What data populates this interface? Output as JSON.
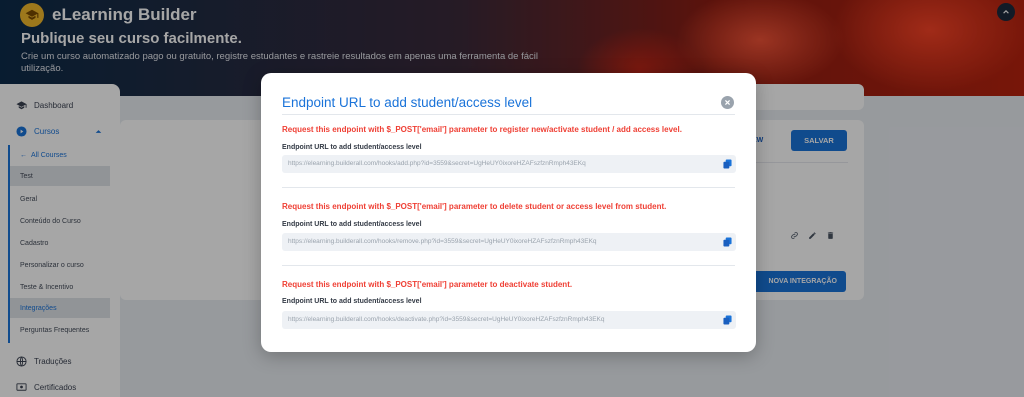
{
  "app": {
    "name": "eLearning Builder",
    "headline": "Publique seu curso facilmente.",
    "subline": "Crie um curso automatizado pago ou gratuito, registre estudantes e rastreie resultados em apenas uma ferramenta de fácil utilização."
  },
  "sidebar": {
    "dashboard": "Dashboard",
    "courses": "Cursos",
    "back": "All Courses",
    "sub_items": [
      "Test",
      "Geral",
      "Conteúdo do Curso",
      "Cadastro",
      "Personalizar o curso",
      "Teste & Incentivo",
      "Integrações",
      "Perguntas Frequentes"
    ],
    "translations": "Traduções",
    "certificates": "Certificados"
  },
  "background": {
    "view_button": "EW",
    "save_button": "SALVAR",
    "new_integration_button": "NOVA INTEGRAÇÃO"
  },
  "modal": {
    "title": "Endpoint URL to add student/access level",
    "sections": [
      {
        "warning": "Request this endpoint with $_POST['email'] parameter to register new/activate student / add access level.",
        "label": "Endpoint URL to add student/access level",
        "url": "https://elearning.builderall.com/hooks/add.php?id=3559&secret=UgHeUY0ixoreHZAFszfznRmph43EKq"
      },
      {
        "warning": "Request this endpoint with $_POST['email'] parameter to delete student or access level from student.",
        "label": "Endpoint URL to add student/access level",
        "url": "https://elearning.builderall.com/hooks/remove.php?id=3559&secret=UgHeUY0ixoreHZAFszfznRmph43EKq"
      },
      {
        "warning": "Request this endpoint with $_POST['email'] parameter to deactivate student.",
        "label": "Endpoint URL to add student/access level",
        "url": "https://elearning.builderall.com/hooks/deactivate.php?id=3559&secret=UgHeUY0ixoreHZAFszfznRmph43EKq"
      }
    ]
  },
  "colors": {
    "accent": "#1a73d9",
    "warning": "#ef3f34"
  }
}
